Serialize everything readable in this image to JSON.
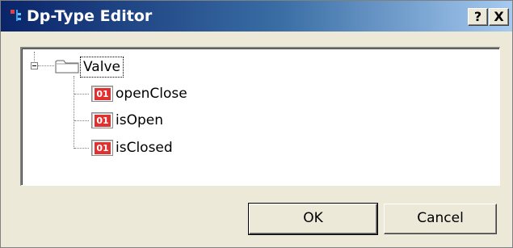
{
  "window": {
    "title": "Dp-Type Editor",
    "help_label": "?",
    "close_label": "X"
  },
  "tree": {
    "root": {
      "label": "Valve",
      "icon": "folder-icon",
      "expanded": true,
      "selected": true
    },
    "children": [
      {
        "label": "openClose",
        "icon": "dpe-bit-icon",
        "badge": "01"
      },
      {
        "label": "isOpen",
        "icon": "dpe-bit-icon",
        "badge": "01"
      },
      {
        "label": "isClosed",
        "icon": "dpe-bit-icon",
        "badge": "01"
      }
    ]
  },
  "buttons": {
    "ok_label": "OK",
    "cancel_label": "Cancel"
  },
  "colors": {
    "titlebar_start": "#0a246a",
    "titlebar_end": "#a6caf0",
    "dialog_bg": "#ece9d8",
    "bit_badge": "#e03030"
  }
}
